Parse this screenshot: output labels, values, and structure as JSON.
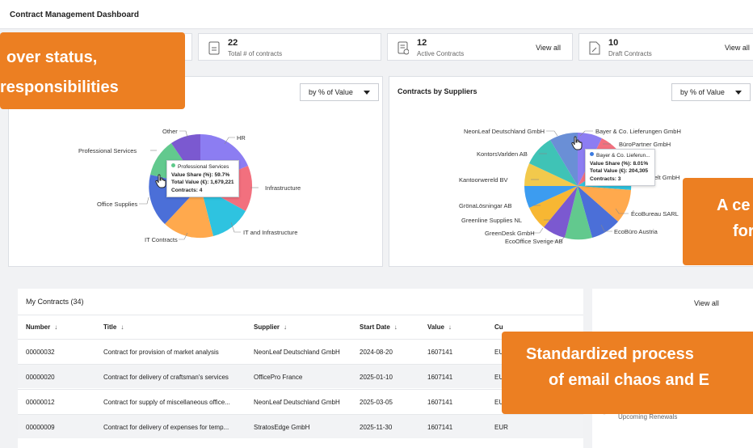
{
  "header": {
    "title": "Contract Management Dashboard"
  },
  "stats": [
    {
      "value": "22",
      "label": "Total # of contracts",
      "icon": "document-icon"
    },
    {
      "value": "12",
      "label": "Active Contracts",
      "action": "View all",
      "icon": "active-contracts-icon"
    },
    {
      "value": "10",
      "label": "Draft Contracts",
      "action": "View all",
      "icon": "draft-contracts-icon"
    }
  ],
  "left_chart": {
    "dropdown": "by % of Value",
    "labels": [
      "Other",
      "HR",
      "Professional Services",
      "Infrastructure",
      "Office Supplies",
      "IT and Infrastructure",
      "IT Contracts"
    ],
    "tooltip": {
      "name": "Professional Services",
      "share": "Value Share (%): 59.7%",
      "total": "Total Value (€): 1,679,221",
      "contracts": "Contracts: 4"
    }
  },
  "right_chart": {
    "title": "Contracts by Suppliers",
    "dropdown": "by % of Value",
    "labels": [
      "NeonLeaf Deutschland GmbH",
      "Bayer & Co. Lieferungen GmbH",
      "BüroPartner GmbH",
      "KontorsVarlden AB",
      "velt GmbH",
      "Kantoorwereld BV",
      "GrönaLösningar AB",
      "ÉcoBureau SARL",
      "Greenline Supplies NL",
      "GreenDesk GmbH",
      "EcoBüro Austria",
      "EcoOffice Sverige AB"
    ],
    "tooltip": {
      "name": "Bayer & Co. Lieferun...",
      "share": "Value Share (%): 8.01%",
      "total": "Total Value (€): 204,305",
      "contracts": "Contracts: 3"
    }
  },
  "contracts": {
    "title": "My Contracts (34)",
    "columns": [
      "Number",
      "Title",
      "Supplier",
      "Start Date",
      "Value",
      "Cu"
    ],
    "rows": [
      {
        "number": "00000032",
        "title": "Contract for provision of market analysis",
        "supplier": "NeonLeaf Deutschland GmbH",
        "start": "2024-08-20",
        "value": "1607141",
        "cur": "EU"
      },
      {
        "number": "00000020",
        "title": "Contract for delivery of craftsman's services",
        "supplier": "OfficePro France",
        "start": "2025-01-10",
        "value": "1607141",
        "cur": "EU"
      },
      {
        "number": "00000012",
        "title": "Contract for supply of miscellaneous office...",
        "supplier": "NeonLeaf Deutschland GmbH",
        "start": "2025-03-05",
        "value": "1607141",
        "cur": "EU"
      },
      {
        "number": "00000009",
        "title": "Contract for delivery of expenses for temp...",
        "supplier": "StratosEdge GmbH",
        "start": "2025-11-30",
        "value": "1607141",
        "cur": "EUR"
      }
    ]
  },
  "side_panel": {
    "action": "View all",
    "upcoming": "Upcoming Renewals"
  },
  "callouts": {
    "top_left": [
      "over status,",
      "responsibilities"
    ],
    "mid_right": [
      "A ce",
      "for"
    ],
    "bottom": [
      "Standardized process",
      "of email chaos and E"
    ]
  },
  "colors": {
    "accent": "#ec7f22",
    "tooltip_dot_green": "#5ec98a",
    "tooltip_dot_blue": "#3b7be0"
  }
}
